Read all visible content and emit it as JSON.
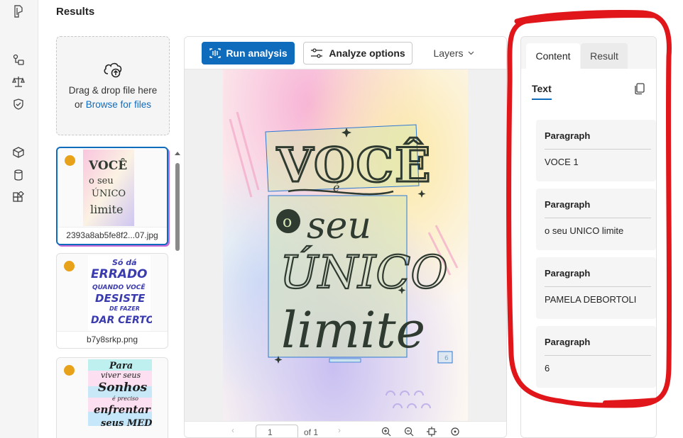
{
  "page": {
    "title": "Results"
  },
  "upload": {
    "line1": "Drag & drop file here",
    "line2_prefix": "or ",
    "browse_link": "Browse for files"
  },
  "files": [
    {
      "name": "2393a8ab5fe8f2...07.jpg",
      "status_color": "#e8a21a",
      "selected": true,
      "preview_text": "VOCÊ é o seu ÚNICO limite"
    },
    {
      "name": "b7y8srkp.png",
      "status_color": "#e8a21a",
      "selected": false,
      "preview_text": "Só dá ERRADO QUANDO VOCÊ DESISTE DE FAZER DAR CERTO"
    },
    {
      "name": "",
      "status_color": "#e8a21a",
      "selected": false,
      "preview_text": "Para viver seus Sonhos é preciso enfrentar seus MEDOS"
    }
  ],
  "toolbar": {
    "run_analysis": "Run analysis",
    "analyze_options": "Analyze options",
    "layers": "Layers"
  },
  "document": {
    "line1": "VOCÊ",
    "line2": "é",
    "line3": "o seu",
    "line4": "ÚNICO",
    "line5": "limite",
    "badge": "6"
  },
  "pager": {
    "current_page": "1",
    "of_label": "of 1"
  },
  "panel": {
    "tabs": [
      "Content",
      "Result"
    ],
    "active_tab": "Content",
    "subtab": "Text",
    "paragraphs": [
      {
        "title": "Paragraph",
        "text": "VOCE 1"
      },
      {
        "title": "Paragraph",
        "text": "o seu UNICO limite"
      },
      {
        "title": "Paragraph",
        "text": "PAMELA DEBORTOLI"
      },
      {
        "title": "Paragraph",
        "text": "6"
      }
    ]
  },
  "colors": {
    "accent": "#0f6cbd",
    "status_dot": "#e8a21a",
    "annotation": "#e0161b"
  },
  "icons": {
    "rail": [
      "logo-icon",
      "flow-icon",
      "scale-icon",
      "shield-icon",
      "box-icon",
      "database-icon",
      "apps-icon"
    ]
  }
}
